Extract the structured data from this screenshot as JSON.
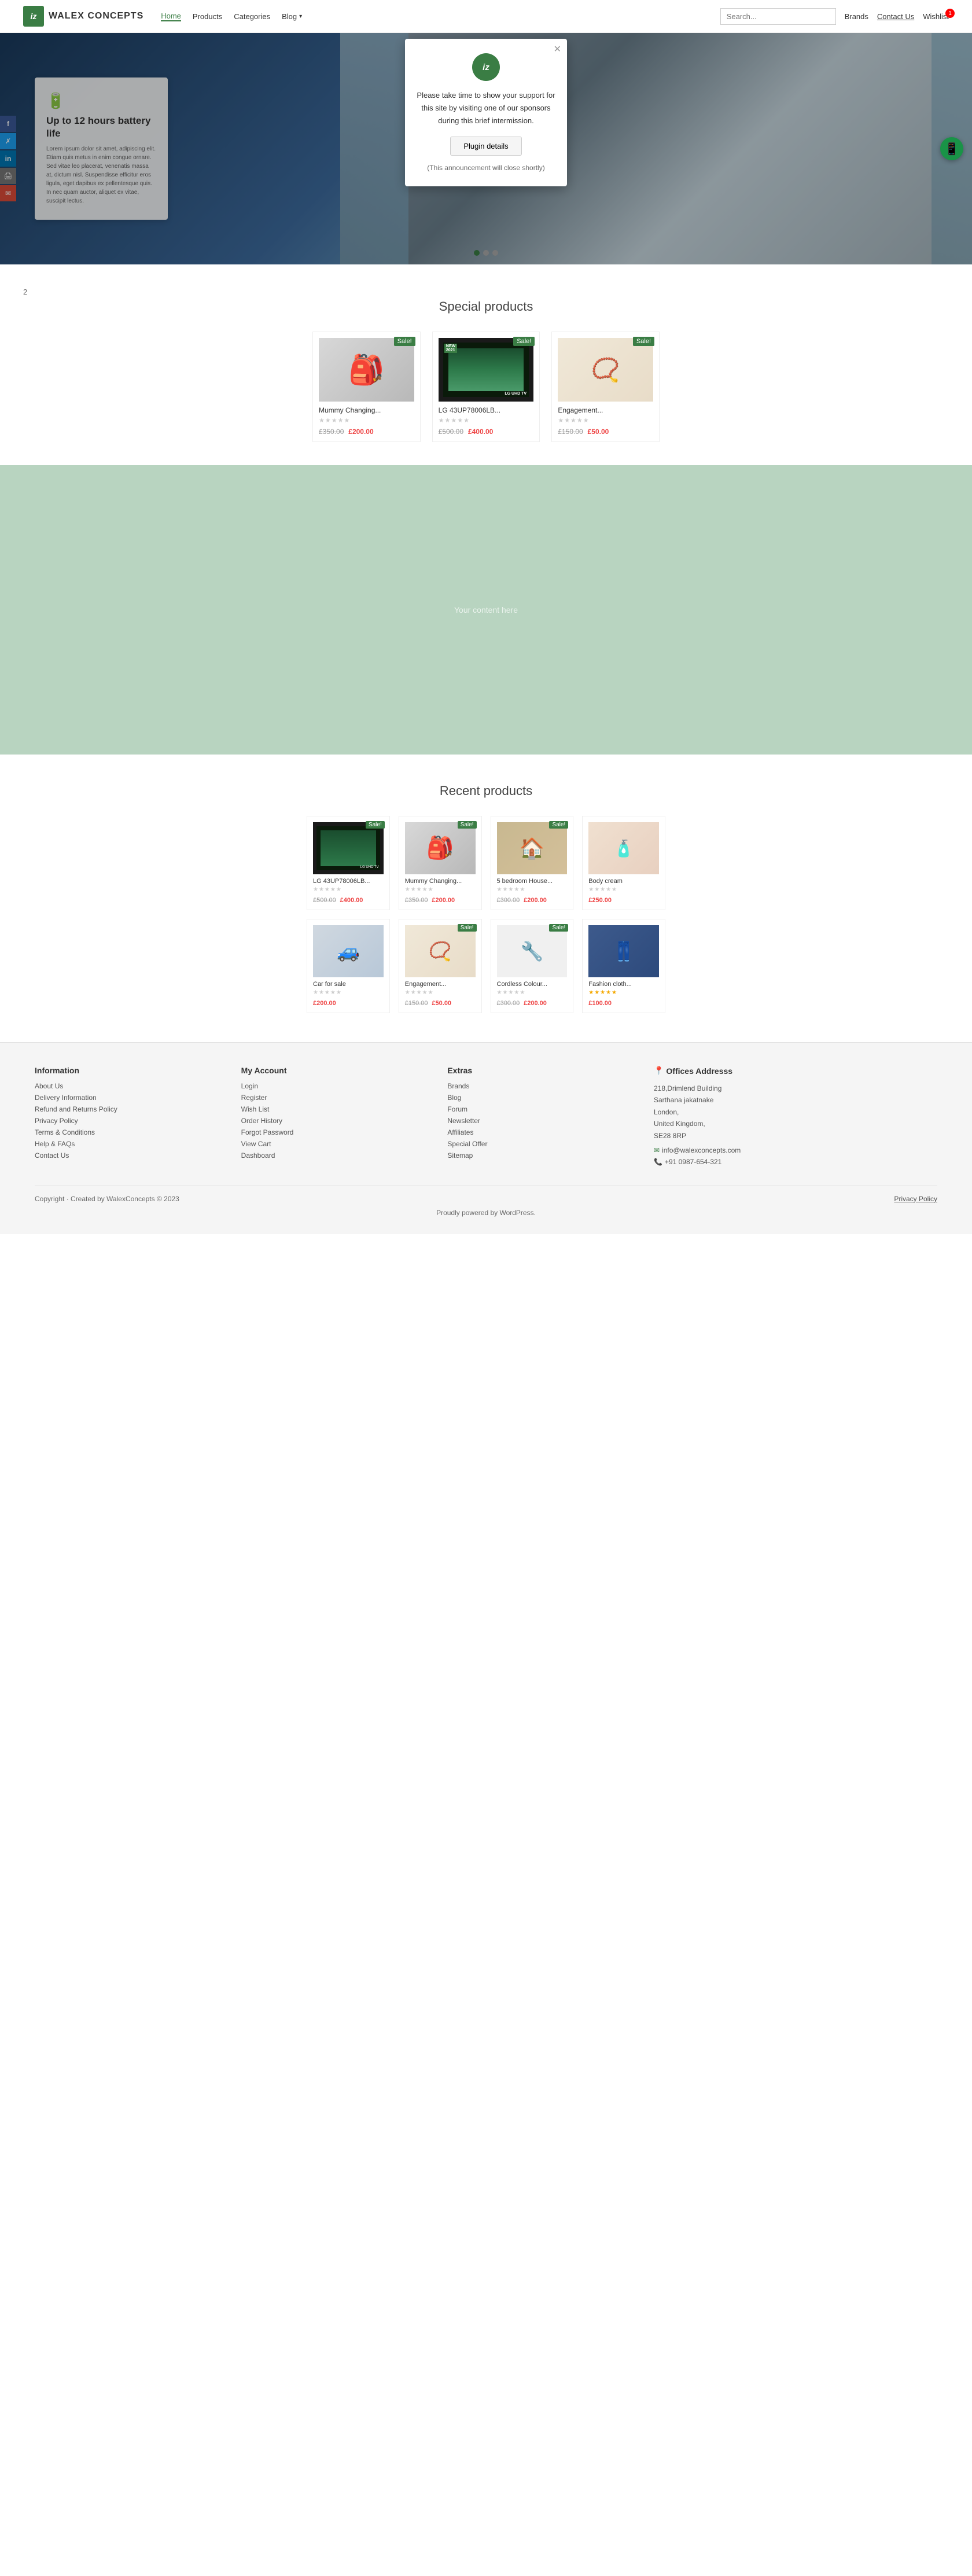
{
  "header": {
    "logo_text": "iz",
    "site_name": "WALEX CONCEPTS",
    "nav": {
      "home": "Home",
      "products": "Products",
      "categories": "Categories",
      "blog": "Blog",
      "brands": "Brands",
      "contact": "Contact Us",
      "wishlist": "Wishlist",
      "wishlist_count": "1"
    },
    "search_placeholder": "Search..."
  },
  "social": {
    "facebook": "f",
    "twitter": "t",
    "linkedin": "in",
    "print": "🖨",
    "email": "✉"
  },
  "modal": {
    "logo_text": "iz",
    "title": "Please take time to show your support for this site by visiting one of our sponsors during this brief intermission.",
    "button_label": "Plugin details",
    "note": "(This announcement will close shortly)"
  },
  "hero": {
    "icon": "🔋",
    "title": "Up to 12 hours battery life",
    "text": "Lorem ipsum dolor sit amet, adipiscing elit. Etiam quis metus in enim congue ornare. Sed vitae leo placerat, venenatis massa at, dictum nisl. Suspendisse efficitur eros ligula, eget dapibus ex pellentesque quis. In nec quam auctor, aliquet ex vitae, suscipit lectus.",
    "dots": [
      1,
      2,
      3
    ],
    "active_dot": 1
  },
  "special_products": {
    "title": "Special products",
    "page_number": "2",
    "products": [
      {
        "name": "Mummy Changing...",
        "price_old": "£350.00",
        "price_new": "£200.00",
        "sale": true,
        "stars": 0,
        "type": "bag"
      },
      {
        "name": "LG 43UP78006LB...",
        "price_old": "£500.00",
        "price_new": "£400.00",
        "sale": true,
        "is_new": true,
        "stars": 0,
        "type": "tv"
      },
      {
        "name": "Engagement...",
        "price_old": "£150.00",
        "price_new": "£50.00",
        "sale": true,
        "stars": 0,
        "type": "necklace"
      }
    ]
  },
  "green_section": {
    "content_label": "Your content here"
  },
  "recent_products": {
    "title": "Recent products",
    "products": [
      {
        "name": "LG 43UP78006LB...",
        "price_old": "£500.00",
        "price_new": "£400.00",
        "sale": true,
        "stars": 0,
        "type": "tv"
      },
      {
        "name": "Mummy Changing...",
        "price_old": "£350.00",
        "price_new": "£200.00",
        "sale": true,
        "stars": 0,
        "type": "bag"
      },
      {
        "name": "5 bedroom House...",
        "price_old": "£300.00",
        "price_new": "£200.00",
        "sale": true,
        "stars": 0,
        "type": "house"
      },
      {
        "name": "Body cream",
        "price_single": "£250.00",
        "sale": false,
        "stars": 0,
        "type": "cream"
      },
      {
        "name": "Car for sale",
        "price_single": "£200.00",
        "sale": false,
        "stars": 0,
        "type": "car"
      },
      {
        "name": "Engagement...",
        "price_old": "£150.00",
        "price_new": "£50.00",
        "sale": true,
        "stars": 0,
        "type": "necklace"
      },
      {
        "name": "Cordless Colour...",
        "price_old": "£300.00",
        "price_new": "£200.00",
        "sale": true,
        "stars": 0,
        "type": "tools"
      },
      {
        "name": "Fashion cloth...",
        "price_single": "£100.00",
        "sale": false,
        "stars": 5,
        "type": "jeans"
      }
    ]
  },
  "footer": {
    "information": {
      "title": "Information",
      "links": [
        "About Us",
        "Delivery Information",
        "Refund and Returns Policy",
        "Privacy Policy",
        "Terms & Conditions",
        "Help & FAQs",
        "Contact Us"
      ]
    },
    "my_account": {
      "title": "My Account",
      "links": [
        "Login",
        "Register",
        "Wish List",
        "Order History",
        "Forgot Password",
        "View Cart",
        "Dashboard"
      ]
    },
    "extras": {
      "title": "Extras",
      "links": [
        "Brands",
        "Blog",
        "Forum",
        "Newsletter",
        "Affiliates",
        "Special Offer",
        "Sitemap"
      ]
    },
    "offices": {
      "title": "Offices Addresss",
      "address_line1": "218,Drimlend Building",
      "address_line2": "Sarthana jakatnake",
      "address_line3": "London,",
      "address_line4": "United Kingdom,",
      "address_line5": "SE28 8RP",
      "email": "info@walexconcepts.com",
      "phone": "+91 0987-654-321"
    },
    "copyright": "Copyright · Created by WalexConcepts © 2023",
    "powered": "Proudly powered by WordPress.",
    "privacy_policy": "Privacy Policy"
  }
}
